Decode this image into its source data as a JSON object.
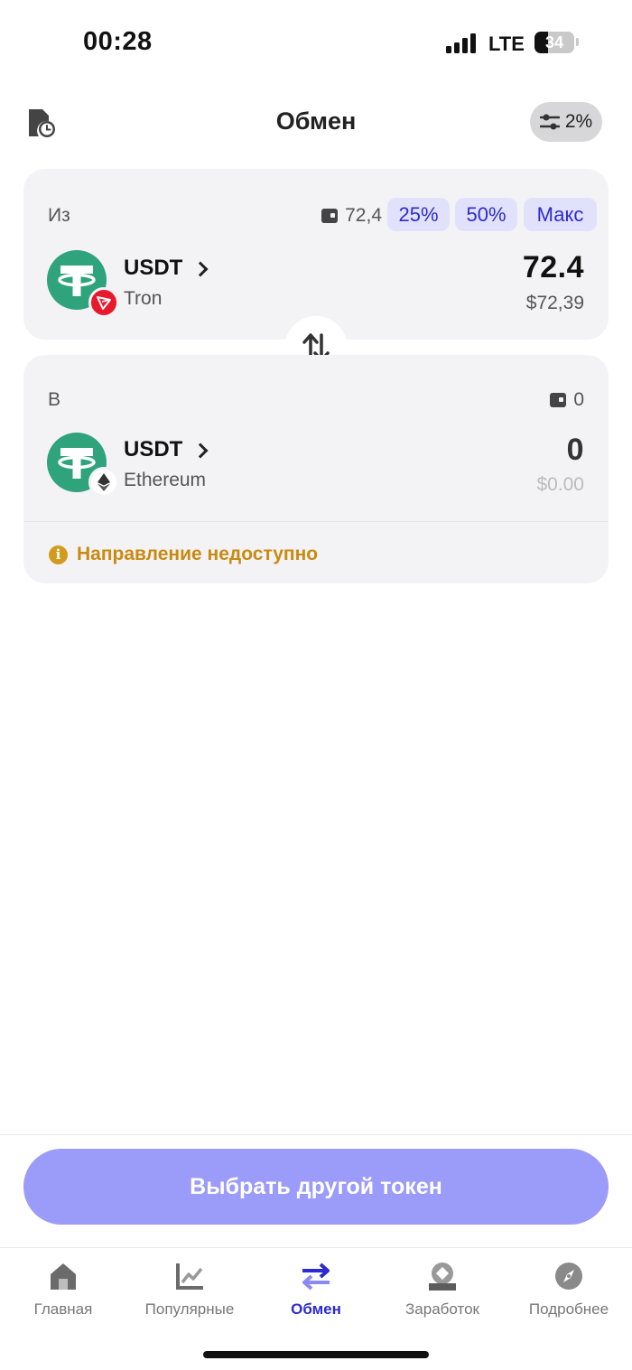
{
  "status_bar": {
    "time": "00:28",
    "network": "LTE",
    "battery_level": "34",
    "battery_fraction": 0.34
  },
  "header": {
    "title": "Обмен",
    "slippage": "2%"
  },
  "from": {
    "label": "Из",
    "balance": "72,4",
    "quick_amounts": [
      "25%",
      "50%",
      "Макс"
    ],
    "token": "USDT",
    "chain": "Tron",
    "amount": "72.4",
    "fiat": "$72,39"
  },
  "to": {
    "label": "В",
    "balance": "0",
    "token": "USDT",
    "chain": "Ethereum",
    "amount": "0",
    "fiat": "$0.00"
  },
  "warning": "Направление недоступно",
  "cta": "Выбрать другой токен",
  "nav": {
    "items": [
      {
        "label": "Главная",
        "icon": "home-icon"
      },
      {
        "label": "Популярные",
        "icon": "chart-icon"
      },
      {
        "label": "Обмен",
        "icon": "swap-icon",
        "active": true
      },
      {
        "label": "Заработок",
        "icon": "earn-icon"
      },
      {
        "label": "Подробнее",
        "icon": "compass-icon"
      }
    ]
  },
  "colors": {
    "accent": "#2b2bd0",
    "cta_disabled": "#9b9bf9",
    "tether_green": "#2fa37c",
    "tron_red": "#e8192c",
    "warning": "#c98a10"
  }
}
